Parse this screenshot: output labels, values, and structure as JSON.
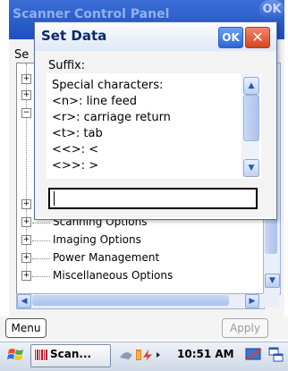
{
  "background_window": {
    "title": "Scanner Control Panel",
    "ok_label": "OK",
    "partial_label": "Se",
    "tree_items": [
      {
        "label": "Scanning Options",
        "expander": "+"
      },
      {
        "label": "Imaging Options",
        "expander": "+"
      },
      {
        "label": "Power Management",
        "expander": "+"
      },
      {
        "label": "Miscellaneous Options",
        "expander": "+"
      }
    ],
    "menu_button": "Menu",
    "apply_button": "Apply"
  },
  "dialog": {
    "title": "Set Data",
    "ok_label": "OK",
    "close_label": "✕",
    "suffix_label": "Suffix:",
    "info_lines": [
      "Special characters:",
      "<n>: line feed",
      "<r>: carriage return",
      "<t>: tab",
      "<<>: <",
      "<>>: >"
    ],
    "input_value": ""
  },
  "taskbar": {
    "task_label": "Scan...",
    "clock": "10:51 AM"
  }
}
